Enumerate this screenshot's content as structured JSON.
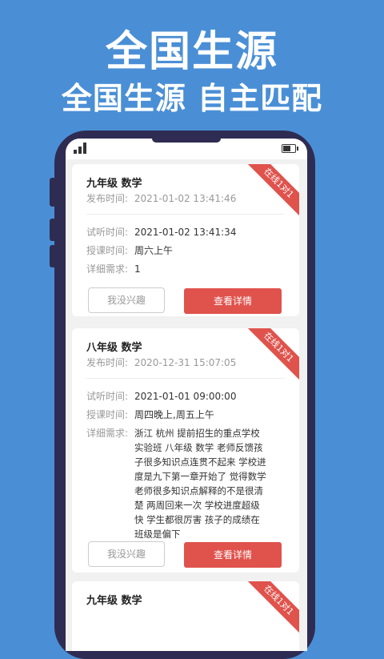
{
  "banner": {
    "title": "全国生源",
    "subtitle": "全国生源  自主匹配"
  },
  "posts": [
    {
      "grade_subject": "九年级 数学",
      "publish_label": "发布时间:",
      "publish_time": "2021-01-02 13:41:46",
      "ribbon": "在线1对1",
      "trial_label": "试听时间:",
      "trial_time": "2021-01-02 13:41:34",
      "lesson_label": "授课时间:",
      "lesson_time": "周六上午",
      "detail_label": "详细需求:",
      "detail": "1",
      "ignore_button": "我没兴趣",
      "view_button": "查看详情"
    },
    {
      "grade_subject": "八年级 数学",
      "publish_label": "发布时间:",
      "publish_time": "2020-12-31 15:07:05",
      "ribbon": "在线1对1",
      "trial_label": "试听时间:",
      "trial_time": "2021-01-01 09:00:00",
      "lesson_label": "授课时间:",
      "lesson_time": "周四晚上,周五上午",
      "detail_label": "详细需求:",
      "detail": "浙江 杭州 提前招生的重点学校实验班 八年级 数学 老师反馈孩子很多知识点连贯不起来 学校进度是九下第一章开始了 觉得数学老师很多知识点解释的不是很清楚 两周回来一次 学校进度超级快 学生都很厉害 孩子的成绩在班级是偏下",
      "ignore_button": "我没兴趣",
      "view_button": "查看详情"
    },
    {
      "grade_subject": "九年级 数学",
      "ribbon": "在线1对1"
    }
  ]
}
